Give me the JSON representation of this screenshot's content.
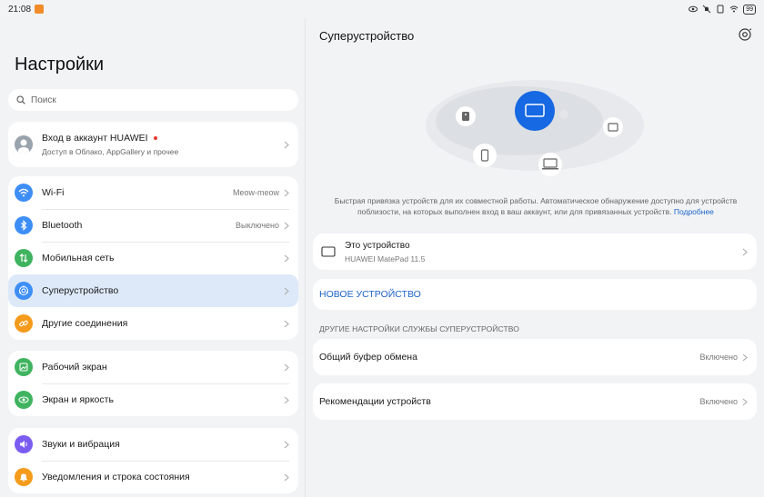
{
  "status_bar": {
    "time": "21:08",
    "battery": "99"
  },
  "left": {
    "title": "Настройки",
    "search": {
      "placeholder": "Поиск"
    },
    "account": {
      "title": "Вход в аккаунт HUAWEI",
      "subtitle": "Доступ в Облако, AppGallery и прочее"
    },
    "groups": [
      [
        {
          "label": "Wi-Fi",
          "value": "Meow-meow",
          "icon": "wifi-icon",
          "color": "#3e8ef7"
        },
        {
          "label": "Bluetooth",
          "value": "Выключено",
          "icon": "bluetooth-icon",
          "color": "#3e8ef7"
        },
        {
          "label": "Мобильная сеть",
          "value": "",
          "icon": "mobile-network-icon",
          "color": "#3fb35f"
        },
        {
          "label": "Суперустройство",
          "value": "",
          "icon": "super-device-icon",
          "color": "#3e8ef7"
        },
        {
          "label": "Другие соединения",
          "value": "",
          "icon": "link-icon",
          "color": "#f59b1b"
        }
      ],
      [
        {
          "label": "Рабочий экран",
          "value": "",
          "icon": "home-screen-icon",
          "color": "#3fb35f"
        },
        {
          "label": "Экран и яркость",
          "value": "",
          "icon": "eye-icon",
          "color": "#3fb35f"
        }
      ],
      [
        {
          "label": "Звуки и вибрация",
          "value": "",
          "icon": "sound-icon",
          "color": "#7b5cf0"
        },
        {
          "label": "Уведомления и строка состояния",
          "value": "",
          "icon": "bell-icon",
          "color": "#f59b1b"
        }
      ]
    ]
  },
  "right": {
    "title": "Суперустройство",
    "description": "Быстрая привязка устройств для их совместной работы. Автоматическое обнаружение доступно для устройств поблизости, на которых выполнен вход в ваш аккаунт, или для привязанных устройств.",
    "learn_more": "Подробнее",
    "this_device": {
      "title": "Это устройство",
      "subtitle": "HUAWEI MatePad 11.5"
    },
    "new_device": "НОВОЕ УСТРОЙСТВО",
    "section_title": "ДРУГИЕ НАСТРОЙКИ СЛУЖБЫ СУПЕРУСТРОЙСТВО",
    "settings": [
      {
        "label": "Общий буфер обмена",
        "value": "Включено"
      },
      {
        "label": "Рекомендации устройств",
        "value": "Включено"
      }
    ]
  },
  "colors": {
    "accent": "#1e64c8",
    "selected_row": "#dde9f8",
    "center_device": "#1668e3"
  }
}
